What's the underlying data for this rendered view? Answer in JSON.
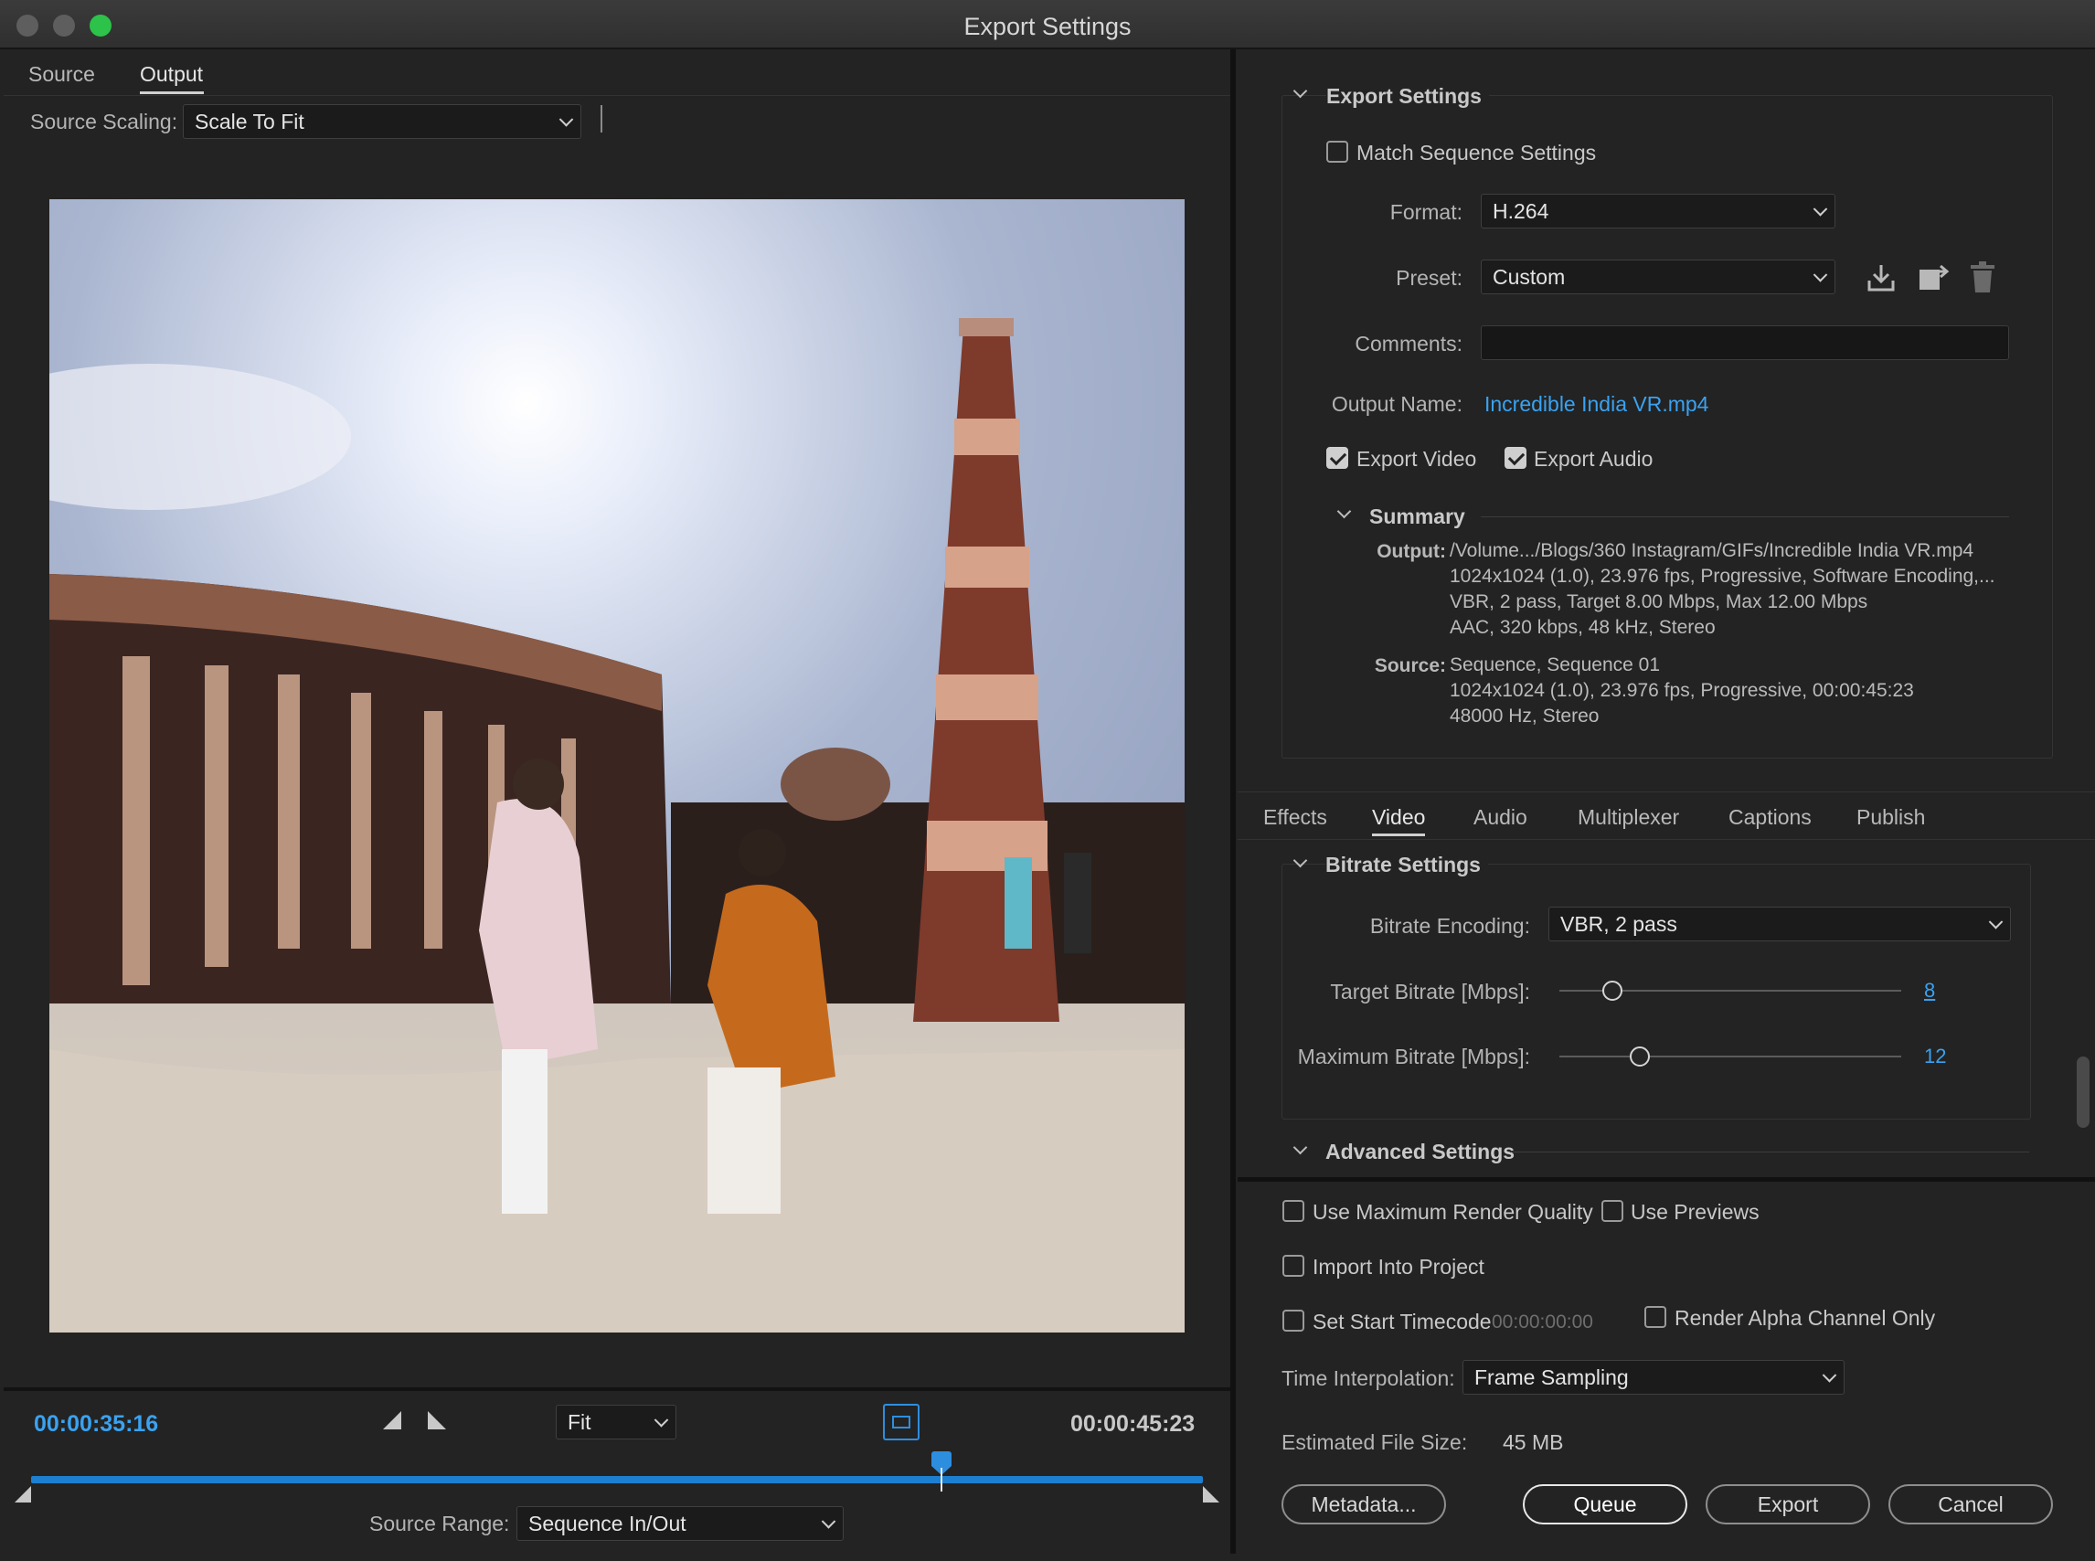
{
  "window": {
    "title": "Export Settings"
  },
  "left": {
    "tabs": [
      {
        "label": "Source"
      },
      {
        "label": "Output"
      }
    ],
    "source_scaling": {
      "label": "Source Scaling:",
      "value": "Scale To Fit"
    },
    "transport": {
      "current_time": "00:00:35:16",
      "duration": "00:00:45:23",
      "zoom": "Fit",
      "playhead_fraction": 0.777
    },
    "source_range": {
      "label": "Source Range:",
      "value": "Sequence In/Out"
    }
  },
  "export_settings": {
    "title": "Export Settings",
    "match_sequence": {
      "label": "Match Sequence Settings",
      "checked": false
    },
    "format": {
      "label": "Format:",
      "value": "H.264"
    },
    "preset": {
      "label": "Preset:",
      "value": "Custom"
    },
    "comments": {
      "label": "Comments:",
      "value": ""
    },
    "output_name": {
      "label": "Output Name:",
      "value": "Incredible India VR.mp4"
    },
    "export_video": {
      "label": "Export Video",
      "checked": true
    },
    "export_audio": {
      "label": "Export Audio",
      "checked": true
    },
    "summary": {
      "title": "Summary",
      "output_key": "Output:",
      "output_lines": [
        "/Volume.../Blogs/360 Instagram/GIFs/Incredible India VR.mp4",
        "1024x1024 (1.0), 23.976 fps, Progressive, Software Encoding,...",
        "VBR, 2 pass, Target 8.00 Mbps, Max 12.00 Mbps",
        "AAC, 320 kbps, 48 kHz, Stereo"
      ],
      "source_key": "Source:",
      "source_lines": [
        "Sequence, Sequence 01",
        "1024x1024 (1.0), 23.976 fps, Progressive, 00:00:45:23",
        "48000 Hz, Stereo"
      ]
    }
  },
  "settings_tabs": [
    {
      "label": "Effects"
    },
    {
      "label": "Video"
    },
    {
      "label": "Audio"
    },
    {
      "label": "Multiplexer"
    },
    {
      "label": "Captions"
    },
    {
      "label": "Publish"
    }
  ],
  "bitrate": {
    "title": "Bitrate Settings",
    "encoding": {
      "label": "Bitrate Encoding:",
      "value": "VBR, 2 pass"
    },
    "target": {
      "label": "Target Bitrate [Mbps]:",
      "value": "8",
      "fraction": 0.155
    },
    "maximum": {
      "label": "Maximum Bitrate [Mbps]:",
      "value": "12",
      "fraction": 0.235
    }
  },
  "advanced": {
    "title": "Advanced Settings"
  },
  "bottom": {
    "max_render_quality": {
      "label": "Use Maximum Render Quality",
      "checked": false
    },
    "use_previews": {
      "label": "Use Previews",
      "checked": false
    },
    "import_into_project": {
      "label": "Import Into Project",
      "checked": false
    },
    "set_start_timecode": {
      "label": "Set Start Timecode",
      "value": "00:00:00:00",
      "checked": false
    },
    "render_alpha": {
      "label": "Render Alpha Channel Only",
      "checked": false
    },
    "time_interpolation": {
      "label": "Time Interpolation:",
      "value": "Frame Sampling"
    },
    "estimated_size": {
      "label": "Estimated File Size:",
      "value": "45 MB"
    },
    "buttons": {
      "metadata": "Metadata...",
      "queue": "Queue",
      "export": "Export",
      "cancel": "Cancel"
    }
  },
  "colors": {
    "accent": "#3aa2f0",
    "timeline": "#1d7fd0"
  }
}
